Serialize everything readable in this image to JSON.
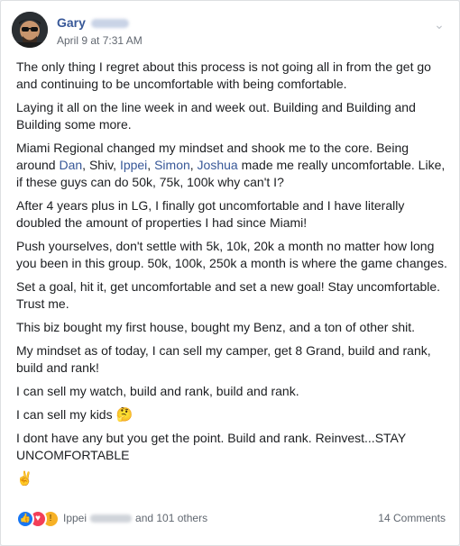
{
  "post": {
    "author_name": "Gary",
    "timestamp": "April 9 at 7:31 AM",
    "paragraphs": [
      "The only thing I regret about this process is not going all in from the get go and continuing to be uncomfortable with being comfortable.",
      "Laying it all on the line week in and week out. Building and Building and Building some more.",
      "After 4 years plus in LG, I finally got uncomfortable and I have literally doubled the amount of properties I had since Miami!",
      "Push yourselves, don't settle with 5k, 10k, 20k a month no matter how long you been in this group. 50k, 100k, 250k a month is where the game changes.",
      "Set a goal, hit it, get uncomfortable and set a new goal! Stay uncomfortable. Trust me.",
      "This biz bought my first house, bought my Benz, and a ton of other shit.",
      "My mindset as of today, I can sell my camper, get 8 Grand, build and rank, build and rank!",
      "I can sell my watch, build and rank, build and rank.",
      "I can sell my kids",
      "I dont have any but you get the point. Build and rank. Reinvest...STAY UNCOMFORTABLE"
    ],
    "miami": {
      "lead": "Miami Regional changed my mindset and shook me to the core. Being around",
      "tags": [
        "Dan",
        "Shiv",
        "Ippei",
        "Simon",
        "Joshua"
      ],
      "tail": "made me really uncomfortable. Like, if these guys can do 50k, 75k, 100k why can't I?"
    },
    "kids_emoji": "🤔",
    "peace_emoji": "✌"
  },
  "footer": {
    "liker_name": "Ippei",
    "others": "and 101 others",
    "comments": "14 Comments"
  },
  "icons": [
    "chevron-down-icon",
    "like-reaction-icon",
    "love-reaction-icon",
    "wow-reaction-icon"
  ],
  "colors": {
    "link": "#385898",
    "text": "#1c1e21",
    "meta": "#616770",
    "like": "#1877f2",
    "love": "#f33e58",
    "wow": "#f7b125"
  }
}
